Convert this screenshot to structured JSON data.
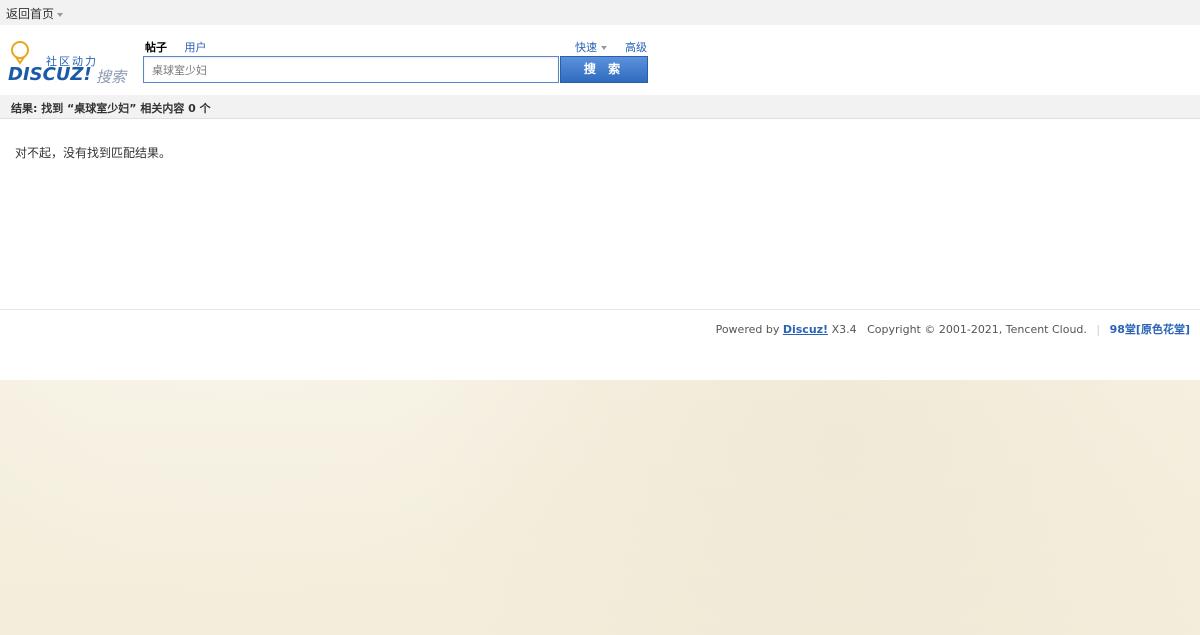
{
  "topbar": {
    "home_link": "返回首页"
  },
  "logo": {
    "tagline": "社区动力",
    "brand": "DISCUZ!",
    "search_word": "搜索"
  },
  "search": {
    "tabs": [
      {
        "label": "帖子",
        "active": true
      },
      {
        "label": "用户",
        "active": false
      }
    ],
    "quick": "快速",
    "advanced": "高级",
    "query": "桌球室少妇",
    "button": "搜 索"
  },
  "result": {
    "summary": "结果: 找到 “桌球室少妇” 相关内容 0 个",
    "empty_message": "对不起，没有找到匹配结果。"
  },
  "footer": {
    "powered_by": "Powered by",
    "brand": "Discuz!",
    "version": "X3.4",
    "copyright": "Copyright © 2001-2021, Tencent Cloud.",
    "separator": "|",
    "site_name": "98堂[原色花堂]"
  },
  "colors": {
    "link_blue": "#2a63b5",
    "button_blue": "#3a76c9",
    "page_background": "#f6f1e2"
  }
}
